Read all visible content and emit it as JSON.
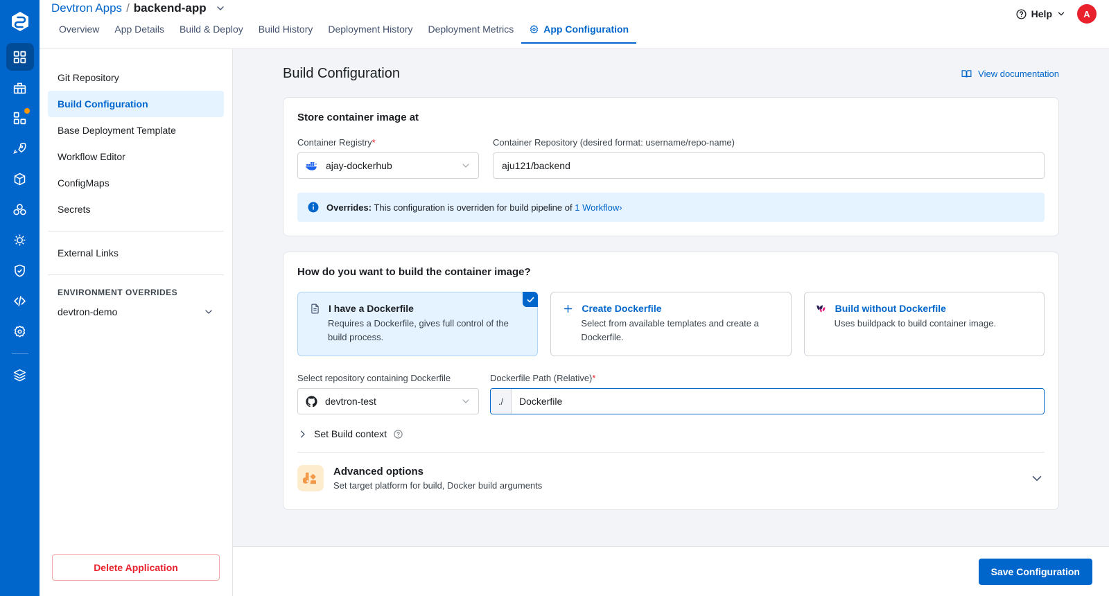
{
  "brand": {
    "logo_icon": "devtron-logo-icon",
    "accent": "#0066cc",
    "rail_bg": "#0066cc"
  },
  "rail": {
    "items": [
      {
        "icon": "apps-grid-icon",
        "active": true,
        "badge": false
      },
      {
        "icon": "chart-grid-icon",
        "active": false,
        "badge": false
      },
      {
        "icon": "app-group-icon",
        "active": false,
        "badge": true
      },
      {
        "icon": "rocket-icon",
        "active": false,
        "badge": false
      },
      {
        "icon": "cube-icon",
        "active": false,
        "badge": false
      },
      {
        "icon": "clusters-icon",
        "active": false,
        "badge": false
      },
      {
        "icon": "bug-icon",
        "active": false,
        "badge": false
      },
      {
        "icon": "shield-check-icon",
        "active": false,
        "badge": false
      },
      {
        "icon": "code-icon",
        "active": false,
        "badge": false
      },
      {
        "icon": "gear-icon",
        "active": false,
        "badge": false
      },
      {
        "icon": "stack-layers-icon",
        "active": false,
        "badge": false
      }
    ]
  },
  "header": {
    "breadcrumb": {
      "parent": "Devtron Apps",
      "separator": "/",
      "current": "backend-app",
      "caret_icon": "chevron-down-icon"
    },
    "tabs": [
      {
        "label": "Overview",
        "active": false,
        "icon": null
      },
      {
        "label": "App Details",
        "active": false,
        "icon": null
      },
      {
        "label": "Build & Deploy",
        "active": false,
        "icon": null
      },
      {
        "label": "Build History",
        "active": false,
        "icon": null
      },
      {
        "label": "Deployment History",
        "active": false,
        "icon": null
      },
      {
        "label": "Deployment Metrics",
        "active": false,
        "icon": null
      },
      {
        "label": "App Configuration",
        "active": true,
        "icon": "gear-icon"
      }
    ],
    "help_label": "Help",
    "help_icon": "question-circle-icon",
    "avatar_initial": "A",
    "avatar_color": "#e8212c"
  },
  "sidebar": {
    "items": [
      {
        "label": "Git Repository",
        "active": false
      },
      {
        "label": "Build Configuration",
        "active": true
      },
      {
        "label": "Base Deployment Template",
        "active": false
      },
      {
        "label": "Workflow Editor",
        "active": false
      },
      {
        "label": "ConfigMaps",
        "active": false
      },
      {
        "label": "Secrets",
        "active": false
      }
    ],
    "external_links_label": "External Links",
    "env_overrides_title": "ENVIRONMENT OVERRIDES",
    "env_item": {
      "label": "devtron-demo",
      "caret_icon": "chevron-down-icon"
    },
    "delete_label": "Delete Application"
  },
  "main": {
    "page_title": "Build Configuration",
    "doc_link": {
      "label": "View documentation",
      "icon": "book-icon"
    },
    "store_card": {
      "title": "Store container image at",
      "registry": {
        "label": "Container Registry",
        "required": "*",
        "value": "ajay-dockerhub",
        "icon": "docker-icon",
        "caret_icon": "chevron-down-icon"
      },
      "repository": {
        "label": "Container Repository (desired format: username/repo-name)",
        "value": "aju121/backend",
        "placeholder": "username/repo-name"
      },
      "overrides": {
        "icon": "info-icon",
        "bold": "Overrides:",
        "text": "This configuration is overriden for build pipeline of",
        "link": "1 Workflow",
        "link_caret": "›"
      }
    },
    "build_card": {
      "question": "How do you want to build the container image?",
      "options": [
        {
          "title": "I have a Dockerfile",
          "desc": "Requires a Dockerfile, gives full control of the build process.",
          "icon": "file-document-icon",
          "selected": true,
          "check_icon": "check-icon"
        },
        {
          "title": "Create Dockerfile",
          "desc": "Select from available templates and create a Dockerfile.",
          "icon": "plus-icon",
          "selected": false
        },
        {
          "title": "Build without Dockerfile",
          "desc": "Uses buildpack to build container image.",
          "icon": "buildpack-icon",
          "selected": false
        }
      ],
      "repo_select": {
        "label": "Select repository containing Dockerfile",
        "value": "devtron-test",
        "icon": "github-icon",
        "caret_icon": "chevron-down-icon"
      },
      "dockerfile_path": {
        "label": "Dockerfile Path (Relative)",
        "required": "*",
        "prefix": "./",
        "value": "Dockerfile",
        "placeholder": "Dockerfile"
      },
      "build_context": {
        "label": "Set Build context",
        "chevron_icon": "chevron-right-icon",
        "help_icon": "question-circle-icon"
      },
      "advanced": {
        "title": "Advanced options",
        "subtitle": "Set target platform for build, Docker build arguments",
        "icon": "advanced-options-icon",
        "caret_icon": "chevron-down-icon"
      }
    },
    "footer": {
      "save_label": "Save Configuration"
    }
  }
}
